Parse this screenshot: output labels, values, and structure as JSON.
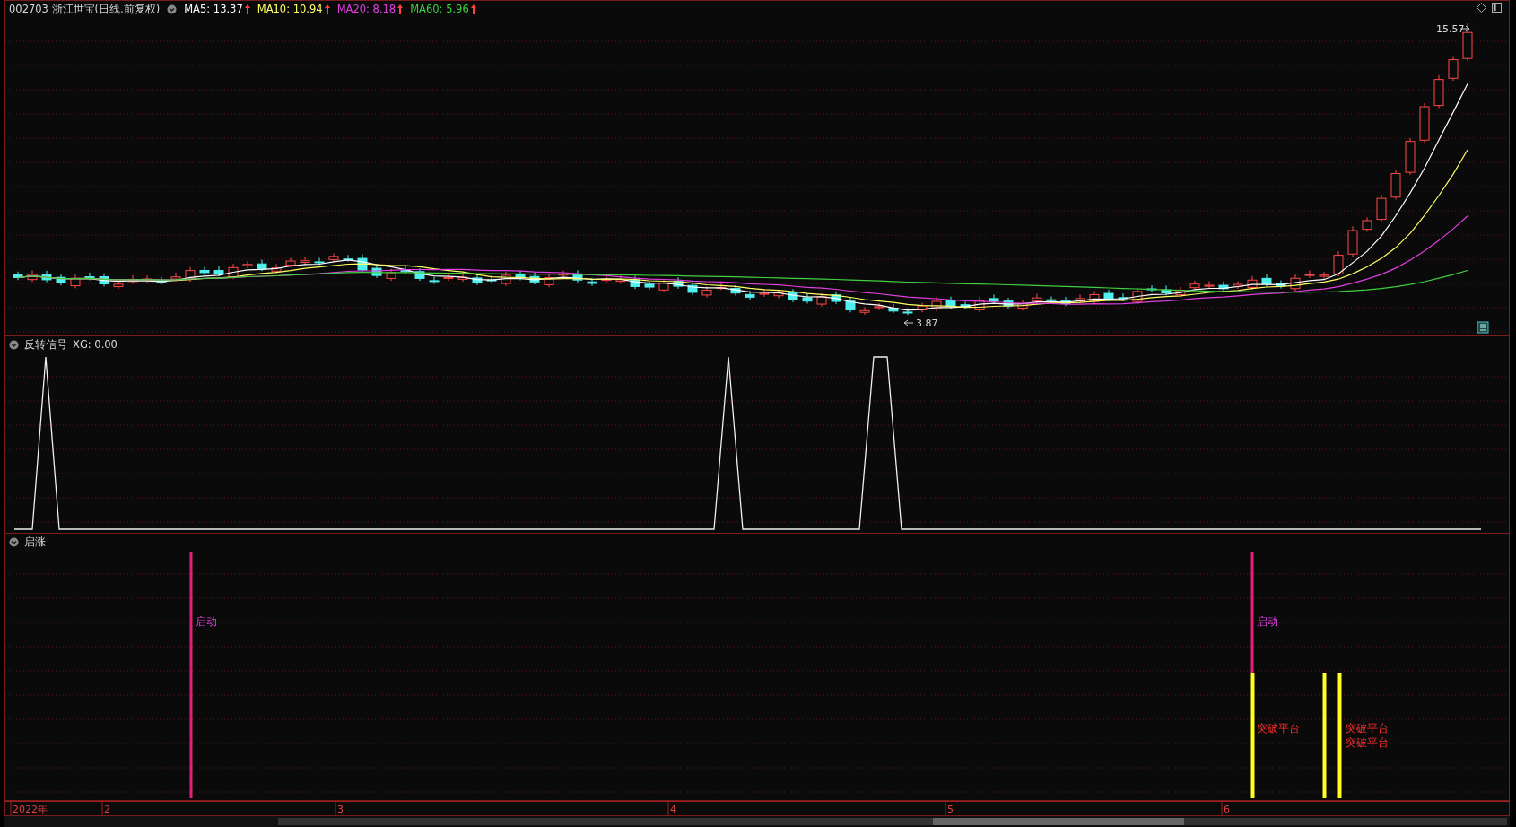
{
  "stock": {
    "code": "002703",
    "name": "浙江世宝(日线.前复权)"
  },
  "legend": [
    {
      "label": "MA5: 13.37",
      "color": "#ffffff"
    },
    {
      "label": "MA10: 10.94",
      "color": "#ffff66"
    },
    {
      "label": "MA20: 8.18",
      "color": "#e040e0"
    },
    {
      "label": "MA60: 5.96",
      "color": "#40d040"
    }
  ],
  "price_labels": {
    "high": "15.57",
    "low": "3.87"
  },
  "indicator": {
    "title": "反转信号",
    "reading": "XG: 0.00"
  },
  "signal_panel": {
    "title": "启涨",
    "signals": [
      {
        "kind": "start",
        "label": "启动"
      },
      {
        "kind": "start",
        "label": "启动"
      },
      {
        "kind": "breakout",
        "label": "突破平台"
      },
      {
        "kind": "breakout",
        "label": "突破平台"
      },
      {
        "kind": "breakout",
        "label": "突破平台"
      }
    ]
  },
  "time_axis": [
    "2022年",
    "2",
    "3",
    "4",
    "5",
    "6"
  ]
}
